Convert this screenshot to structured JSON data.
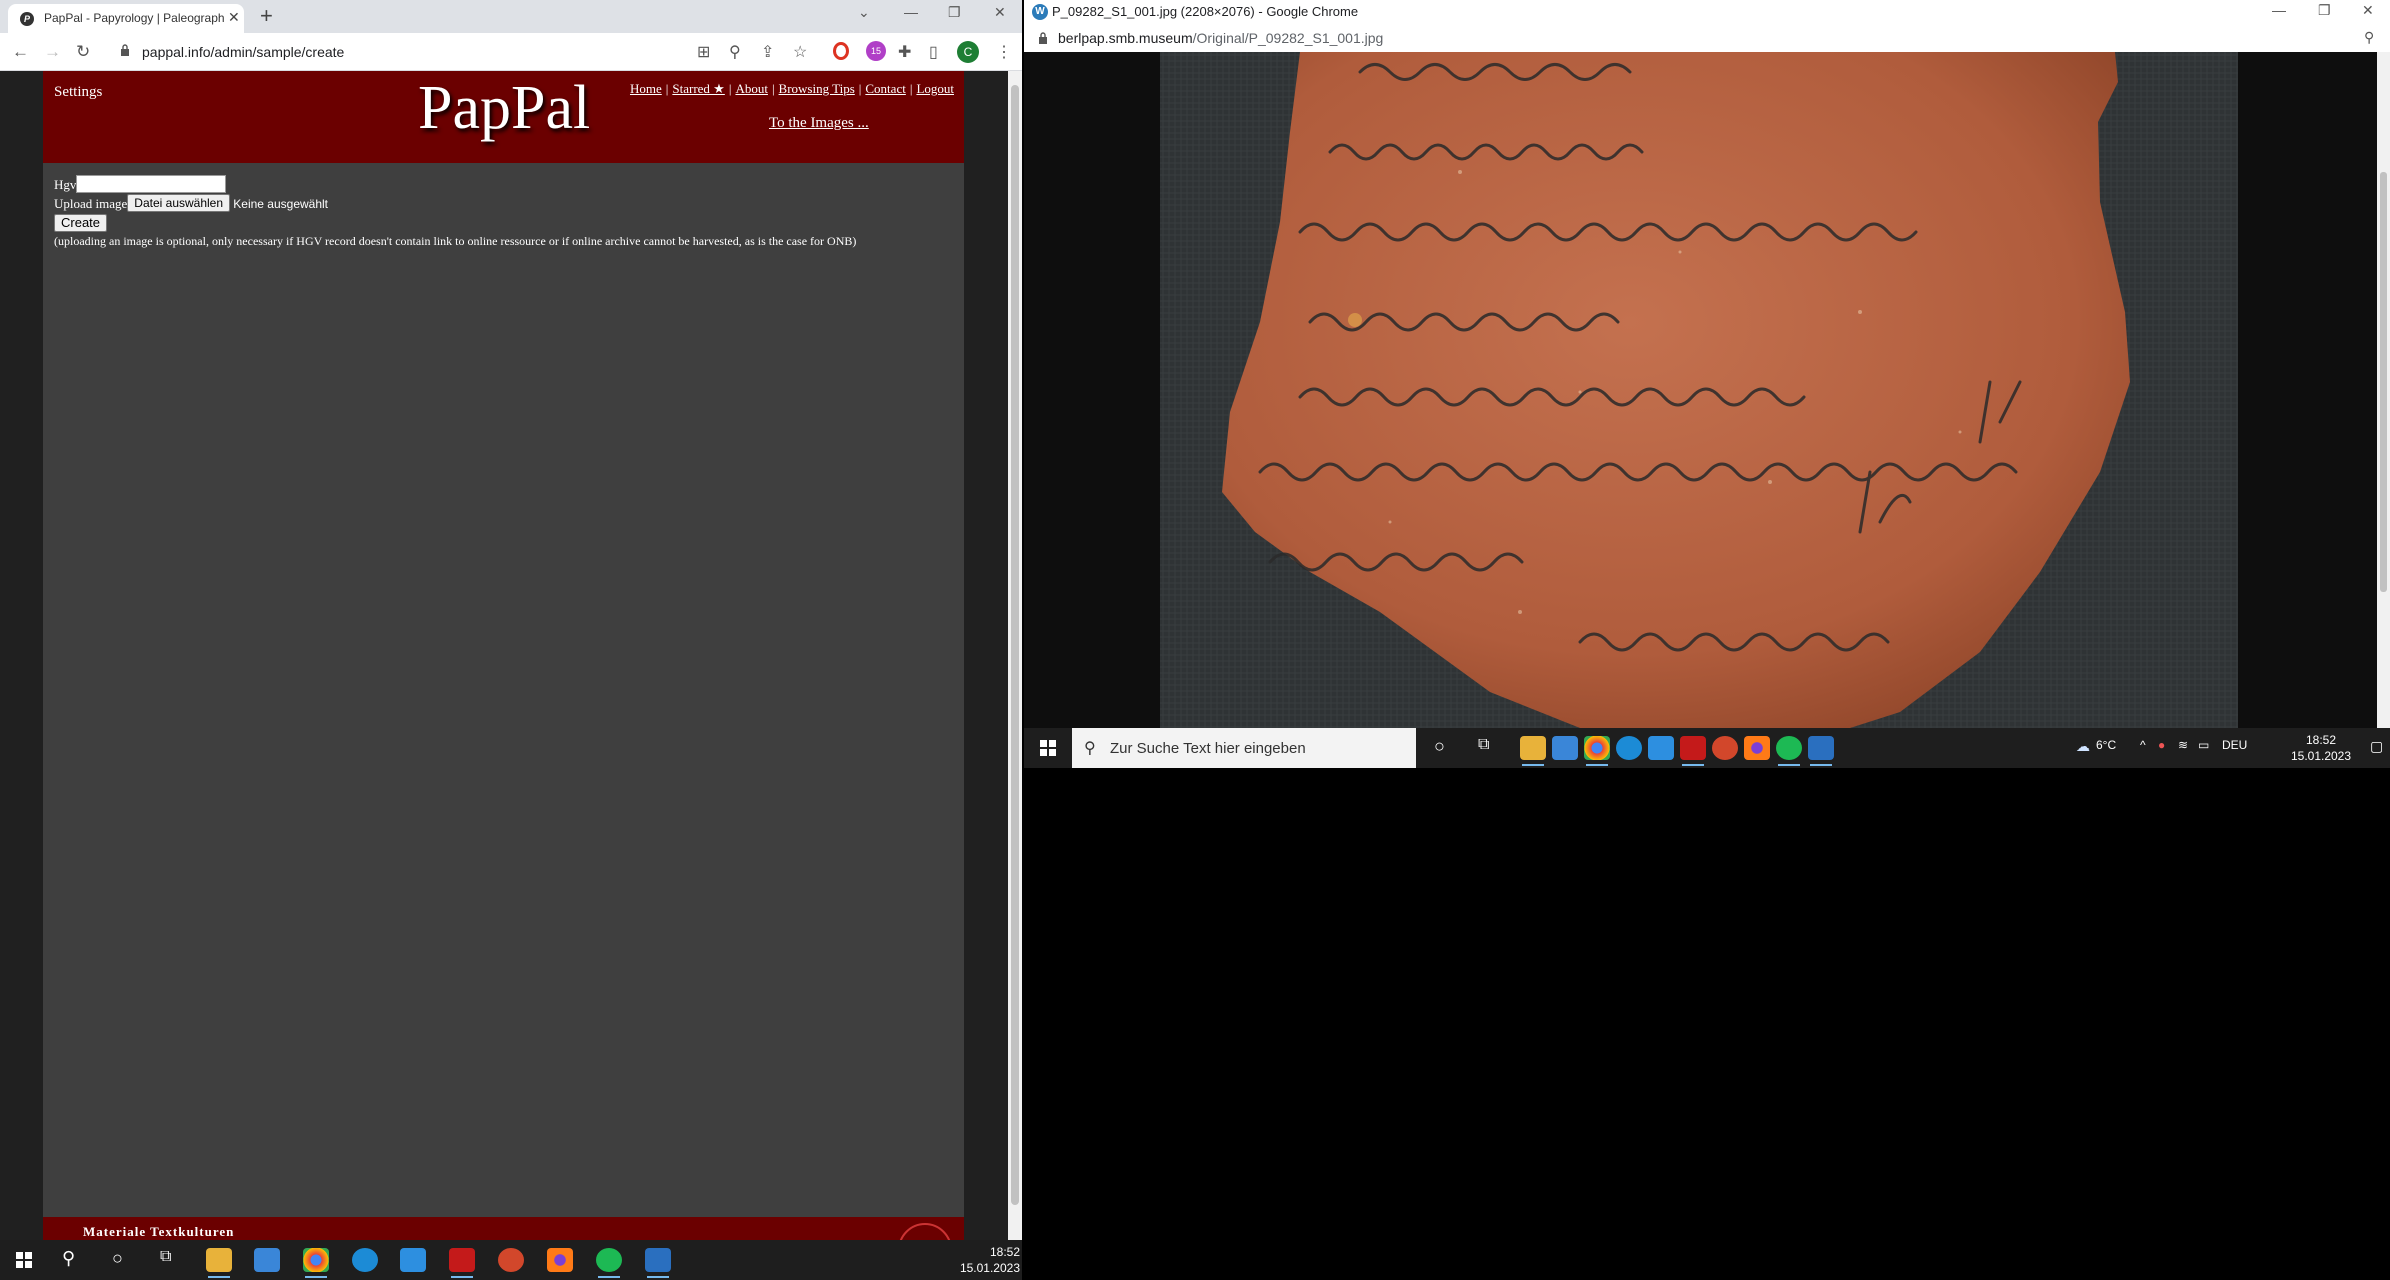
{
  "left_browser": {
    "tab_title": "PapPal - Papyrology | Paleography",
    "url": "pappal.info/admin/sample/create"
  },
  "pappal": {
    "settings_label": "Settings",
    "logo": "PapPal",
    "nav": [
      "Home",
      "Starred ★",
      "About",
      "Browsing Tips",
      "Contact",
      "Logout"
    ],
    "to_images": "To the Images ...",
    "form": {
      "hgv_label": "Hgv",
      "hgv_value": "",
      "upload_label": "Upload image",
      "file_button": "Datei auswählen",
      "file_status": "Keine ausgewählt",
      "create_button": "Create",
      "note": "(uploading an image is optional, only necessary if HGV record doesn't contain link to online ressource or if online archive cannot be harvested, as is the case for ONB)"
    },
    "footer_text": "Materiale Textkulturen"
  },
  "right_browser": {
    "window_title": "P_09282_S1_001.jpg (2208×2076) - Google Chrome",
    "url_host": "berlpap.smb.museum",
    "url_path": "/Original/P_09282_S1_001.jpg"
  },
  "right_taskbar": {
    "search_placeholder": "Zur Suche Text hier eingeben",
    "weather": "6°C",
    "lang": "DEU",
    "time": "18:52",
    "date": "15.01.2023"
  },
  "bottom_taskbar": {
    "time": "18:52",
    "date": "15.01.2023"
  },
  "colors": {
    "banner": "#6b0000",
    "page_bg": "#3f3f3f",
    "sherd": "#b8603f"
  }
}
